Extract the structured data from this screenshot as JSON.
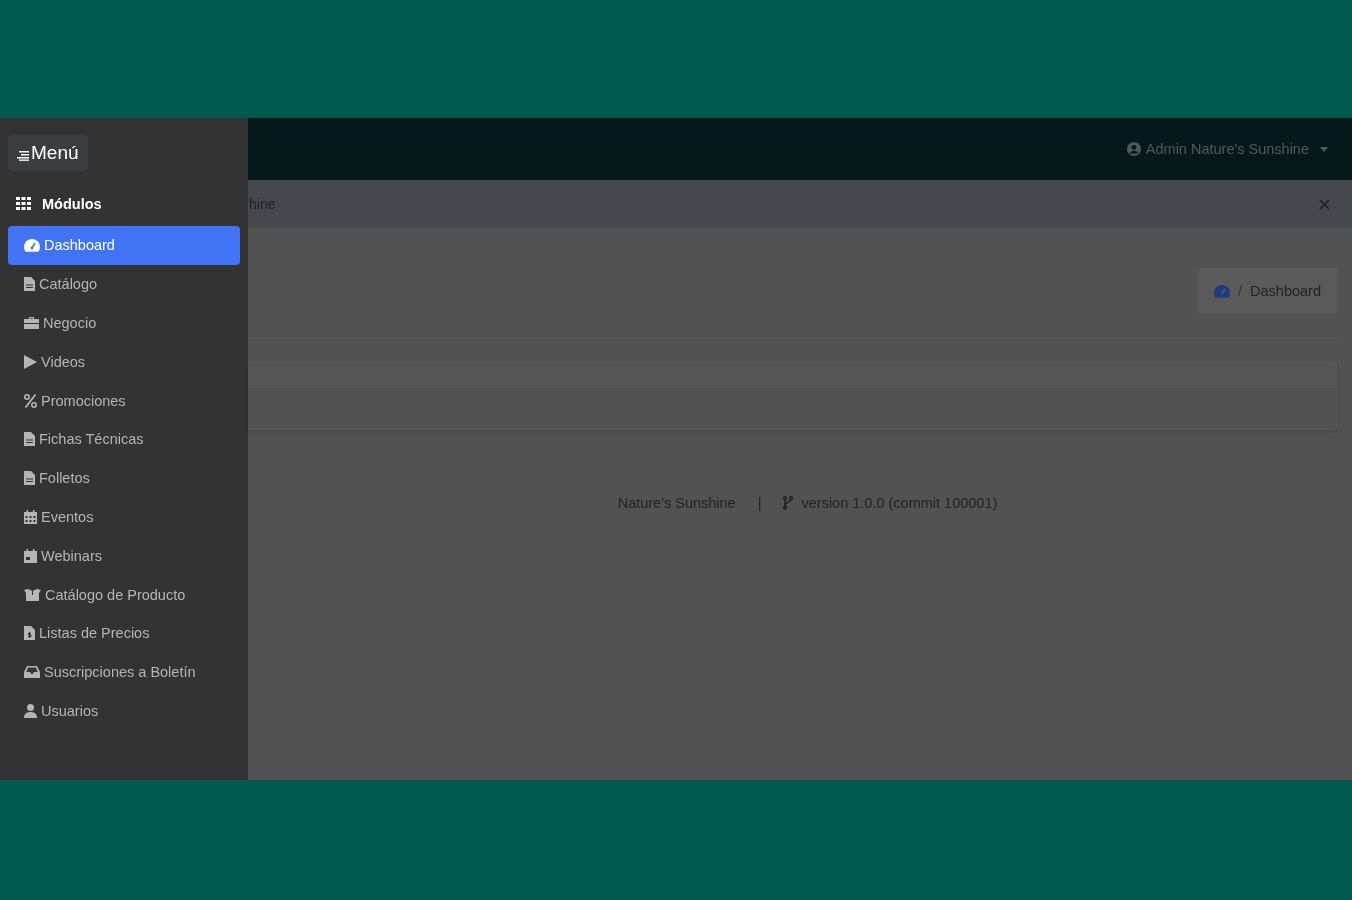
{
  "sidebar": {
    "menu_button": "Menú",
    "section_title": "Módulos",
    "items": [
      {
        "label": "Dashboard",
        "kind": "gauge",
        "selected": true
      },
      {
        "label": "Catálogo",
        "kind": "file",
        "selected": false
      },
      {
        "label": "Negocio",
        "kind": "briefcase",
        "selected": false
      },
      {
        "label": "Videos",
        "kind": "play",
        "selected": false
      },
      {
        "label": "Promociones",
        "kind": "percent",
        "selected": false
      },
      {
        "label": "Fichas Técnicas",
        "kind": "file",
        "selected": false
      },
      {
        "label": "Folletos",
        "kind": "file",
        "selected": false
      },
      {
        "label": "Eventos",
        "kind": "calendar",
        "selected": false
      },
      {
        "label": "Webinars",
        "kind": "webinar",
        "selected": false
      },
      {
        "label": "Catálogo de Producto",
        "kind": "boxes",
        "selected": false
      },
      {
        "label": "Listas de Precios",
        "kind": "invoice",
        "selected": false
      },
      {
        "label": "Suscripciones a Boletín",
        "kind": "inbox",
        "selected": false
      },
      {
        "label": "Usuarios",
        "kind": "user",
        "selected": false
      }
    ]
  },
  "navbar": {
    "user_menu": "Admin Nature's Sunshine"
  },
  "alert": {
    "text": "hine"
  },
  "breadcrumb": {
    "separator": "/",
    "current": "Dashboard"
  },
  "footer": {
    "brand": "Nature's Sunshine",
    "separator": "|",
    "version": "version 1.0.0 (commit 100001)"
  }
}
